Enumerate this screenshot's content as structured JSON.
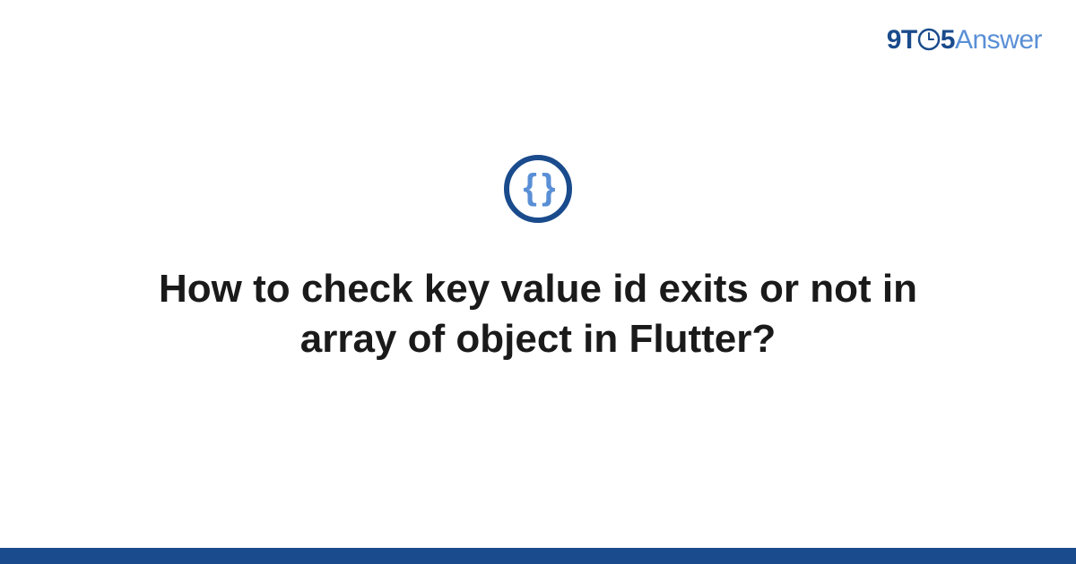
{
  "logo": {
    "prefix": "9T",
    "middle": "5",
    "suffix": "Answer"
  },
  "icon": {
    "name": "code-braces"
  },
  "title": "How to check key value id exits or not in array of object in Flutter?",
  "colors": {
    "primary": "#1a4b8c",
    "accent": "#5a8fd6",
    "text": "#1a1a1a"
  }
}
